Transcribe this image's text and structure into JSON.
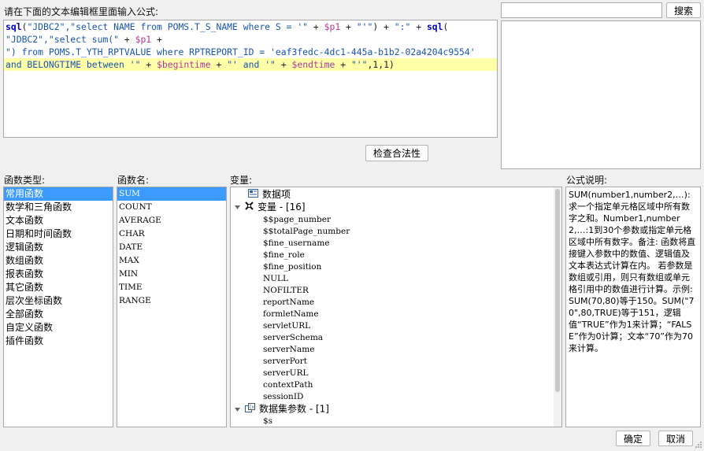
{
  "editor": {
    "prompt": "请在下面的文本编辑框里面输入公式:",
    "lines": [
      [
        {
          "t": "sql",
          "c": "kw"
        },
        {
          "t": "(",
          "c": "op"
        },
        {
          "t": "\"JDBC2\",\"select NAME from POMS.T_S_NAME where S = '\"",
          "c": "str"
        },
        {
          "t": " + ",
          "c": "op"
        },
        {
          "t": "$p1",
          "c": "var"
        },
        {
          "t": " + ",
          "c": "op"
        },
        {
          "t": "\"'\"",
          "c": "str"
        },
        {
          "t": ") + ",
          "c": "op"
        },
        {
          "t": "\":\"",
          "c": "str"
        },
        {
          "t": " + ",
          "c": "op"
        },
        {
          "t": "sql",
          "c": "kw"
        },
        {
          "t": "(",
          "c": "op"
        }
      ],
      [
        {
          "t": "\"JDBC2\",\"select sum(\"",
          "c": "str"
        },
        {
          "t": " + ",
          "c": "op"
        },
        {
          "t": "$p1",
          "c": "var"
        },
        {
          "t": " +",
          "c": "op"
        }
      ],
      [
        {
          "t": "\") from POMS.T_YTH_RPTVALUE where RPTREPORT_ID = 'eaf3fedc-4dc1-445a-b1b2-02a4204c9554'",
          "c": "str"
        }
      ],
      [
        {
          "t": "and BELONGTIME between '\"",
          "c": "str"
        },
        {
          "t": " + ",
          "c": "op"
        },
        {
          "t": "$begintime",
          "c": "var"
        },
        {
          "t": " + ",
          "c": "op"
        },
        {
          "t": "\"' and '\"",
          "c": "str"
        },
        {
          "t": " + ",
          "c": "op"
        },
        {
          "t": "$endtime",
          "c": "var"
        },
        {
          "t": " + ",
          "c": "op"
        },
        {
          "t": "\"'\"",
          "c": "str"
        },
        {
          "t": ",1,1)",
          "c": "op"
        }
      ]
    ],
    "check_button": "检查合法性"
  },
  "search": {
    "value": "",
    "button": "搜索"
  },
  "labels": {
    "func_type": "函数类型:",
    "func_name": "函数名:",
    "variables": "变量:",
    "description": "公式说明:"
  },
  "func_types": [
    "常用函数",
    "数学和三角函数",
    "文本函数",
    "日期和时间函数",
    "逻辑函数",
    "数组函数",
    "报表函数",
    "其它函数",
    "层次坐标函数",
    "全部函数",
    "自定义函数",
    "插件函数"
  ],
  "func_names": [
    "SUM",
    "COUNT",
    "AVERAGE",
    "CHAR",
    "DATE",
    "MAX",
    "MIN",
    "TIME",
    "RANGE"
  ],
  "tree": {
    "data_item": "数据项",
    "variables_node": "变量 - [16]",
    "vars": [
      "$$page_number",
      "$$totalPage_number",
      "$fine_username",
      "$fine_role",
      "$fine_position",
      "NULL",
      "NOFILTER",
      "reportName",
      "formletName",
      "servletURL",
      "serverSchema",
      "serverName",
      "serverPort",
      "serverURL",
      "contextPath",
      "sessionID"
    ],
    "dataset_params": "数据集参数 - [1]",
    "params": [
      "$s"
    ]
  },
  "description_text": "SUM(number1,number2,…): 求一个指定单元格区域中所有数字之和。Number1,number2,…:1到30个参数或指定单元格区域中所有数字。备注:    函数将直接键入参数中的数值、逻辑值及文本表达式计算在内。    若参数是数组或引用，则只有数组或单元格引用中的数值进行计算。示例:SUM(70,80)等于150。SUM(\"70\",80,TRUE)等于151，逻辑值“TRUE”作为1来计算；“FALSE”作为0计算；文本“70”作为70来计算。",
  "footer": {
    "ok": "确定",
    "cancel": "取消"
  },
  "colors": {
    "selection": "#3d9bff",
    "highlight": "#ffffa8",
    "keyword": "#0000c8",
    "string": "#1a55b0",
    "variable": "#b3399b"
  }
}
